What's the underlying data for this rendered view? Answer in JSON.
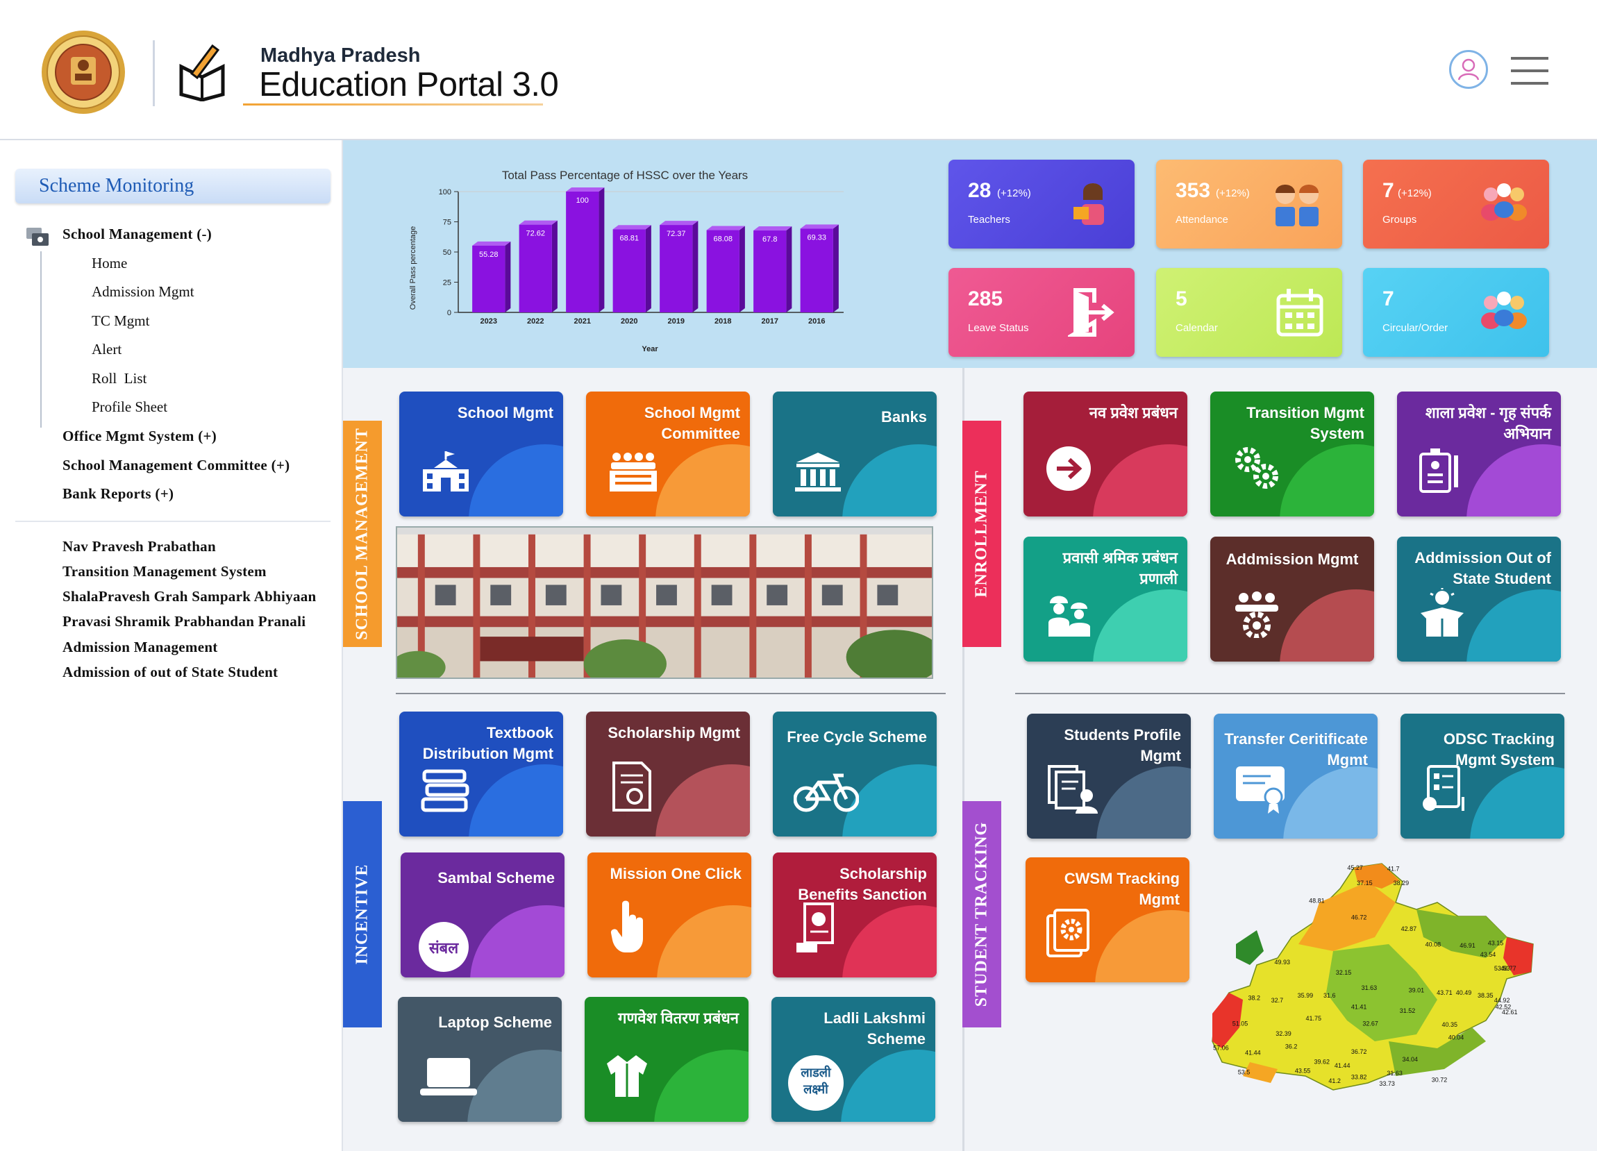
{
  "header": {
    "portal_sub": "Madhya Pradesh",
    "portal_title": "Education Portal 3.0",
    "user_icon": "user-icon",
    "menu_icon": "hamburger-menu-icon"
  },
  "sidebar": {
    "title": "Scheme Monitoring",
    "tree": [
      {
        "label": "School Management (-)",
        "bold": true
      },
      {
        "label": "Home"
      },
      {
        "label": "Admission Mgmt"
      },
      {
        "label": "TC Mgmt"
      },
      {
        "label": "Alert"
      },
      {
        "label": "Roll  List"
      },
      {
        "label": "Profile Sheet"
      },
      {
        "label": "Office Mgmt System (+)",
        "bold": true
      },
      {
        "label": "School Management Committee (+)",
        "bold": true
      },
      {
        "label": "Bank Reports (+)",
        "bold": true
      }
    ],
    "links": [
      "Nav Pravesh Prabathan",
      "Transition Management System",
      "ShalaPravesh Grah Sampark Abhiyaan",
      "Pravasi Shramik Prabhandan Pranali",
      "Admission Management",
      "Admission of out of State Student"
    ]
  },
  "chart_data": {
    "type": "bar",
    "title": "Total Pass Percentage of HSSC over the Years",
    "xlabel": "Year",
    "ylabel": "Overall Pass percentage",
    "categories": [
      "2023",
      "2022",
      "2021",
      "2020",
      "2019",
      "2018",
      "2017",
      "2016"
    ],
    "values": [
      55.28,
      72.62,
      100,
      68.81,
      72.37,
      68.08,
      67.8,
      69.33
    ],
    "value_labels": [
      "55.28",
      "72.62",
      "100",
      "68.81",
      "72.37",
      "68.08",
      "67.8",
      "69.33"
    ],
    "ylim": [
      0,
      100
    ],
    "yticks": [
      "0",
      "25",
      "50",
      "75",
      "100"
    ],
    "bar_color": "#8a12e0",
    "grid": false
  },
  "stats": [
    {
      "value": "28",
      "change": "(+12%)",
      "label": "Teachers",
      "color": "#5b4fe0"
    },
    {
      "value": "353",
      "change": "(+12%)",
      "label": "Attendance",
      "color": "#fbb066"
    },
    {
      "value": "7",
      "change": "(+12%)",
      "label": "Groups",
      "color": "#f26a50"
    },
    {
      "value": "285",
      "change": "",
      "label": "Leave Status",
      "color": "#ec4d8b"
    },
    {
      "value": "5",
      "change": "",
      "label": "Calendar",
      "color": "#c5ef64"
    },
    {
      "value": "7",
      "change": "",
      "label": "Circular/Order",
      "color": "#4ccaf0"
    }
  ],
  "sections": {
    "school_management": "SCHOOL MANAGEMENT",
    "enrollment": "ENROLLMENT",
    "incentive": "INCENTIVE",
    "student_tracking": "STUDENT TRACKING"
  },
  "tiles": {
    "school_mgmt": "School Mgmt",
    "school_mgmt_committee": "School Mgmt Committee",
    "banks": "Banks",
    "nav_pravesh": "नव प्रवेश प्रबंधन",
    "transition_mgmt": "Transition Mgmt System",
    "shala_pravesh": "शाला प्रवेश - गृह संपर्क अभियान",
    "pravasi_shramik": "प्रवासी श्रमिक प्रबंधन प्रणाली",
    "addmission_mgmt": "Addmission Mgmt",
    "admission_out_state": "Addmission Out of State Student",
    "textbook": "Textbook Distribution Mgmt",
    "scholarship_mgmt": "Scholarship Mgmt",
    "free_cycle": "Free Cycle Scheme",
    "sambal": "Sambal Scheme",
    "sambal_logo": "संबल",
    "mission_one_click": "Mission One Click",
    "scholarship_benefits": "Scholarship Benefits Sanction",
    "laptop": "Laptop Scheme",
    "ganvesh": "गणवेश वितरण प्रबंधन",
    "ladli_lakshmi": "Ladli Lakshmi Scheme",
    "ladli_logo_1": "लाडली",
    "ladli_logo_2": "लक्ष्मी",
    "students_profile": "Students Profile Mgmt",
    "transfer_certificate": "Transfer Ceritificate Mgmt",
    "odsc_tracking": "ODSC Tracking Mgmt System",
    "cwsm_tracking": "CWSM Tracking Mgmt"
  },
  "map_labels": [
    "45.27",
    "41.7",
    "37.15",
    "38.29",
    "48.81",
    "46.72",
    "42.87",
    "40.08",
    "46.91",
    "43.15",
    "43.54",
    "48.77",
    "53.53",
    "49.93",
    "32.15",
    "31.63",
    "39.01",
    "43.71",
    "40.49",
    "38.35",
    "44.92",
    "42.52",
    "42.61",
    "38.2",
    "32.7",
    "35.99",
    "31.6",
    "41.41",
    "31.52",
    "40.35",
    "51.05",
    "41.75",
    "32.67",
    "40.04",
    "32.39",
    "36.2",
    "36.72",
    "34.04",
    "41.44",
    "39.62",
    "31.63",
    "57.06",
    "41.44",
    "33.82",
    "33.73",
    "30.72",
    "53.5",
    "43.55",
    "41.2"
  ]
}
